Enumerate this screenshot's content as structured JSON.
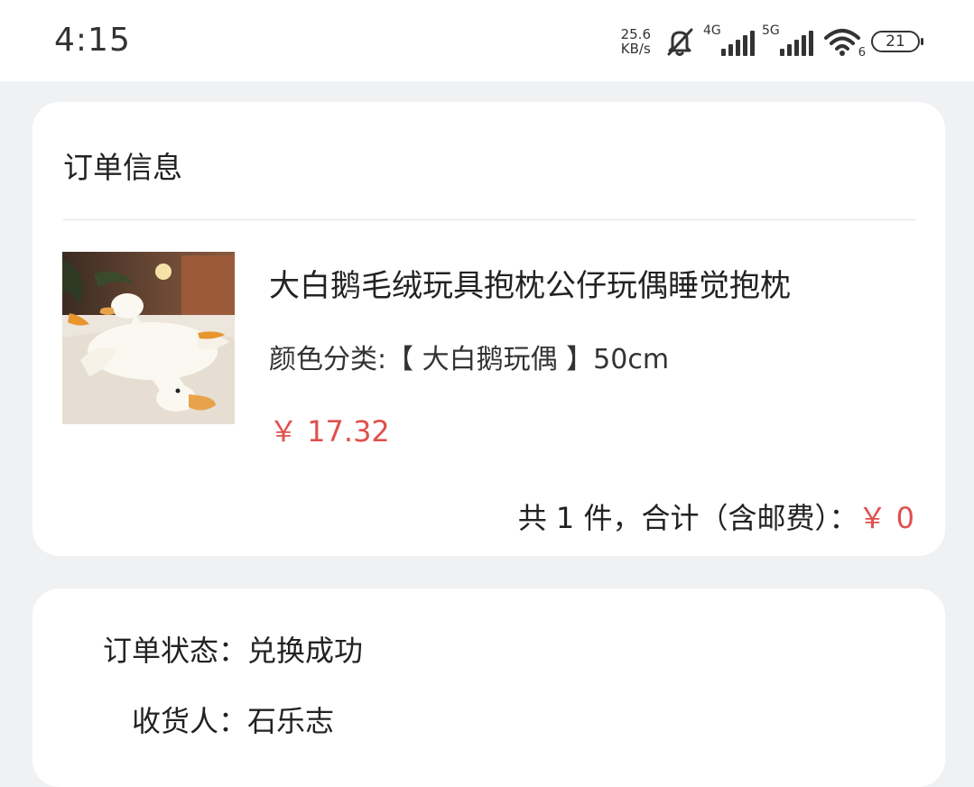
{
  "status_bar": {
    "time": "4:15",
    "net_speed_value": "25.6",
    "net_speed_unit": "KB/s",
    "signal_1_label": "4G",
    "signal_2_label": "5G",
    "wifi_badge": "6",
    "battery_level": "21",
    "icons": [
      "bell-muted-icon",
      "signal-icon",
      "signal-icon",
      "wifi-icon",
      "battery-icon"
    ]
  },
  "order_info": {
    "title": "订单信息",
    "product": {
      "name": "大白鹅毛绒玩具抱枕公仔玩偶睡觉抱枕",
      "spec": "颜色分类:【 大白鹅玩偶 】50cm",
      "price": "￥ 17.32"
    },
    "total_label": "共 1 件，合计（含邮费）：",
    "total_value": "￥ 0",
    "colors": {
      "price": "#e0504d"
    }
  },
  "order_status": {
    "status_label": "订单状态：",
    "status_value": "兑换成功",
    "receiver_label": "收货人：",
    "receiver_value": "石乐志"
  }
}
